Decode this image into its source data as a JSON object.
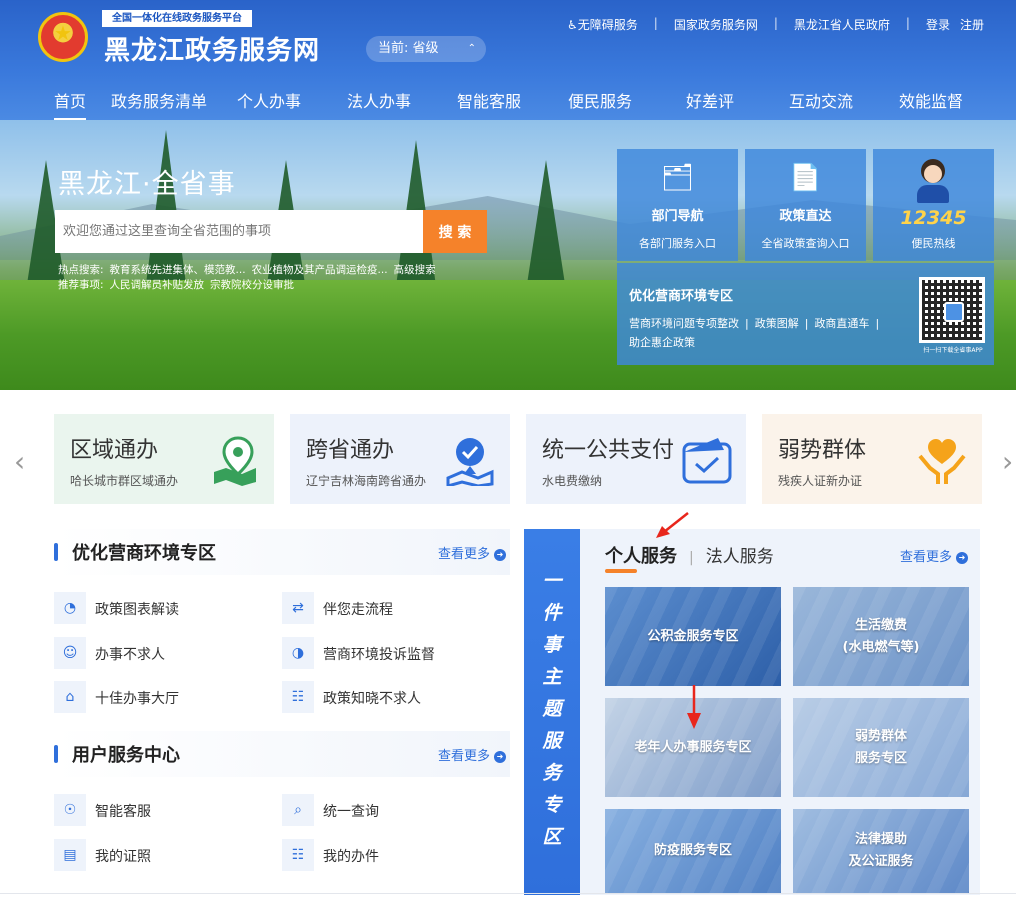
{
  "header": {
    "platform_tag": "全国一体化在线政务服务平台",
    "site_title": "黑龙江政务服务网",
    "region": "当前: 省级",
    "toplinks": {
      "accessible": "♿无障碍服务",
      "national": "国家政务服务网",
      "provincial_gov": "黑龙江省人民政府",
      "login": "登录",
      "register": "注册"
    },
    "nav": [
      "首页",
      "政务服务清单",
      "个人办事",
      "法人办事",
      "智能客服",
      "便民服务",
      "好差评",
      "互动交流",
      "效能监督"
    ]
  },
  "hero": {
    "title": "黑龙江·全省事",
    "search_placeholder": "欢迎您通过这里查询全省范围的事项",
    "search_button": "搜 索",
    "hot_label": "热点搜索:",
    "hot_items": [
      "教育系统先进集体、模范教...",
      "农业植物及其产品调运检疫...",
      "高级搜索"
    ],
    "recommend_label": "推荐事项:",
    "recommend_items": [
      "人民调解员补贴发放",
      "宗教院校分设审批"
    ],
    "cards": [
      {
        "title": "部门导航",
        "subtitle": "各部门服务入口",
        "icon": "folder-icon"
      },
      {
        "title": "政策直达",
        "subtitle": "全省政策查询入口",
        "icon": "document-star-icon"
      },
      {
        "title": "12345",
        "subtitle": "便民热线",
        "icon": "operator-icon"
      }
    ],
    "biz_panel": {
      "title": "优化营商环境专区",
      "links": [
        "营商环境问题专项整改",
        "政策图解",
        "政商直通车"
      ],
      "link2": "助企惠企政策"
    },
    "qr_caption": "扫一扫下载全省事APP"
  },
  "quick_cards": [
    {
      "title": "区域通办",
      "subtitle": "哈长城市群区域通办",
      "bg": "#eaf5ee",
      "icon": "map-pin-icon"
    },
    {
      "title": "跨省通办",
      "subtitle": "辽宁吉林海南跨省通办",
      "bg": "#edf2fb",
      "icon": "location-check-icon"
    },
    {
      "title": "统一公共支付",
      "subtitle": "水电费缴纳",
      "bg": "#edf2fb",
      "icon": "payment-check-icon"
    },
    {
      "title": "弱势群体",
      "subtitle": "残疾人证新办证",
      "bg": "#fbf3ea",
      "icon": "heart-hands-icon"
    }
  ],
  "left": {
    "section1": {
      "title": "优化营商环境专区",
      "more": "查看更多",
      "items": [
        {
          "label": "政策图表解读",
          "icon": "chart-icon"
        },
        {
          "label": "伴您走流程",
          "icon": "flow-icon"
        },
        {
          "label": "办事不求人",
          "icon": "person-icon"
        },
        {
          "label": "营商环境投诉监督",
          "icon": "complaint-icon"
        },
        {
          "label": "十佳办事大厅",
          "icon": "hall-icon"
        },
        {
          "label": "政策知晓不求人",
          "icon": "policy-icon"
        }
      ]
    },
    "section2": {
      "title": "用户服务中心",
      "more": "查看更多",
      "items": [
        {
          "label": "智能客服",
          "icon": "robot-icon"
        },
        {
          "label": "统一查询",
          "icon": "search-doc-icon"
        },
        {
          "label": "我的证照",
          "icon": "license-icon"
        },
        {
          "label": "我的办件",
          "icon": "case-icon"
        }
      ]
    }
  },
  "right": {
    "vertical_banner": [
      "一",
      "件",
      "事",
      "主",
      "题",
      "服",
      "务",
      "专",
      "区"
    ],
    "tab_personal": "个人服务",
    "tab_legal": "法人服务",
    "more": "查看更多",
    "tiles": [
      "公积金服务专区",
      "生活缴费\n(水电燃气等)",
      "老年人办事服务专区",
      "弱势群体\n服务专区",
      "防疫服务专区",
      "法律援助\n及公证服务"
    ]
  }
}
